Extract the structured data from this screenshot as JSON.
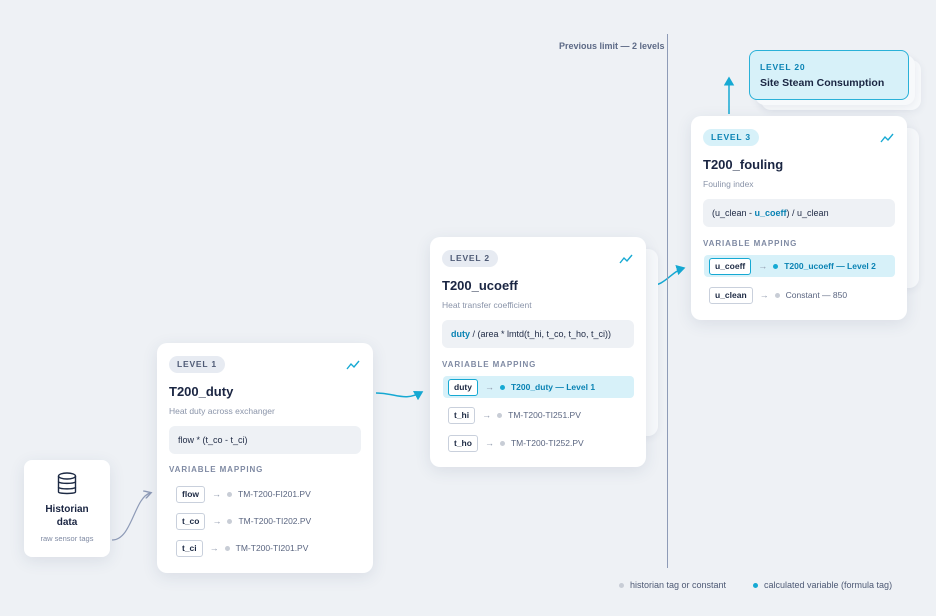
{
  "divider_label": "Previous limit — 2 levels",
  "historian": {
    "title_line1": "Historian",
    "title_line2": "data",
    "subtitle": "raw sensor tags",
    "icon": "database-icon"
  },
  "level20": {
    "pill": "LEVEL 20",
    "title": "Site Steam Consumption"
  },
  "vm_heading": "VARIABLE MAPPING",
  "cards": [
    {
      "pill": "LEVEL 1",
      "title": "T200_duty",
      "subtitle": "Heat duty across exchanger",
      "formula": {
        "pre": "flow * (t_co - t_ci)",
        "calc": "",
        "post": ""
      },
      "rows": [
        {
          "tag": "flow",
          "source": "TM-T200-FI201.PV",
          "calc": false
        },
        {
          "tag": "t_co",
          "source": "TM-T200-TI202.PV",
          "calc": false
        },
        {
          "tag": "t_ci",
          "source": "TM-T200-TI201.PV",
          "calc": false
        }
      ]
    },
    {
      "pill": "LEVEL 2",
      "title": "T200_ucoeff",
      "subtitle": "Heat transfer coefficient",
      "formula": {
        "pre": "",
        "calc": "duty",
        "post": " / (area * lmtd(t_hi, t_co, t_ho, t_ci))"
      },
      "rows": [
        {
          "tag": "duty",
          "source": "T200_duty — Level 1",
          "calc": true
        },
        {
          "tag": "t_hi",
          "source": "TM-T200-TI251.PV",
          "calc": false
        },
        {
          "tag": "t_ho",
          "source": "TM-T200-TI252.PV",
          "calc": false
        }
      ]
    },
    {
      "pill": "LEVEL 3",
      "title": "T200_fouling",
      "subtitle": "Fouling index",
      "formula": {
        "pre": "(u_clean - ",
        "calc": "u_coeff",
        "post": ") / u_clean"
      },
      "rows": [
        {
          "tag": "u_coeff",
          "source": "T200_ucoeff — Level 2",
          "calc": true
        },
        {
          "tag": "u_clean",
          "source": "Constant — 850",
          "calc": false
        }
      ]
    }
  ],
  "legend": [
    {
      "label": "historian tag or constant",
      "color": "#c8cdd6"
    },
    {
      "label": "calculated variable (formula tag)",
      "color": "#16a9d3"
    }
  ],
  "colors": {
    "accent": "#16a9d3",
    "background": "#eef1f5",
    "highlight": "#d7f1f9"
  }
}
